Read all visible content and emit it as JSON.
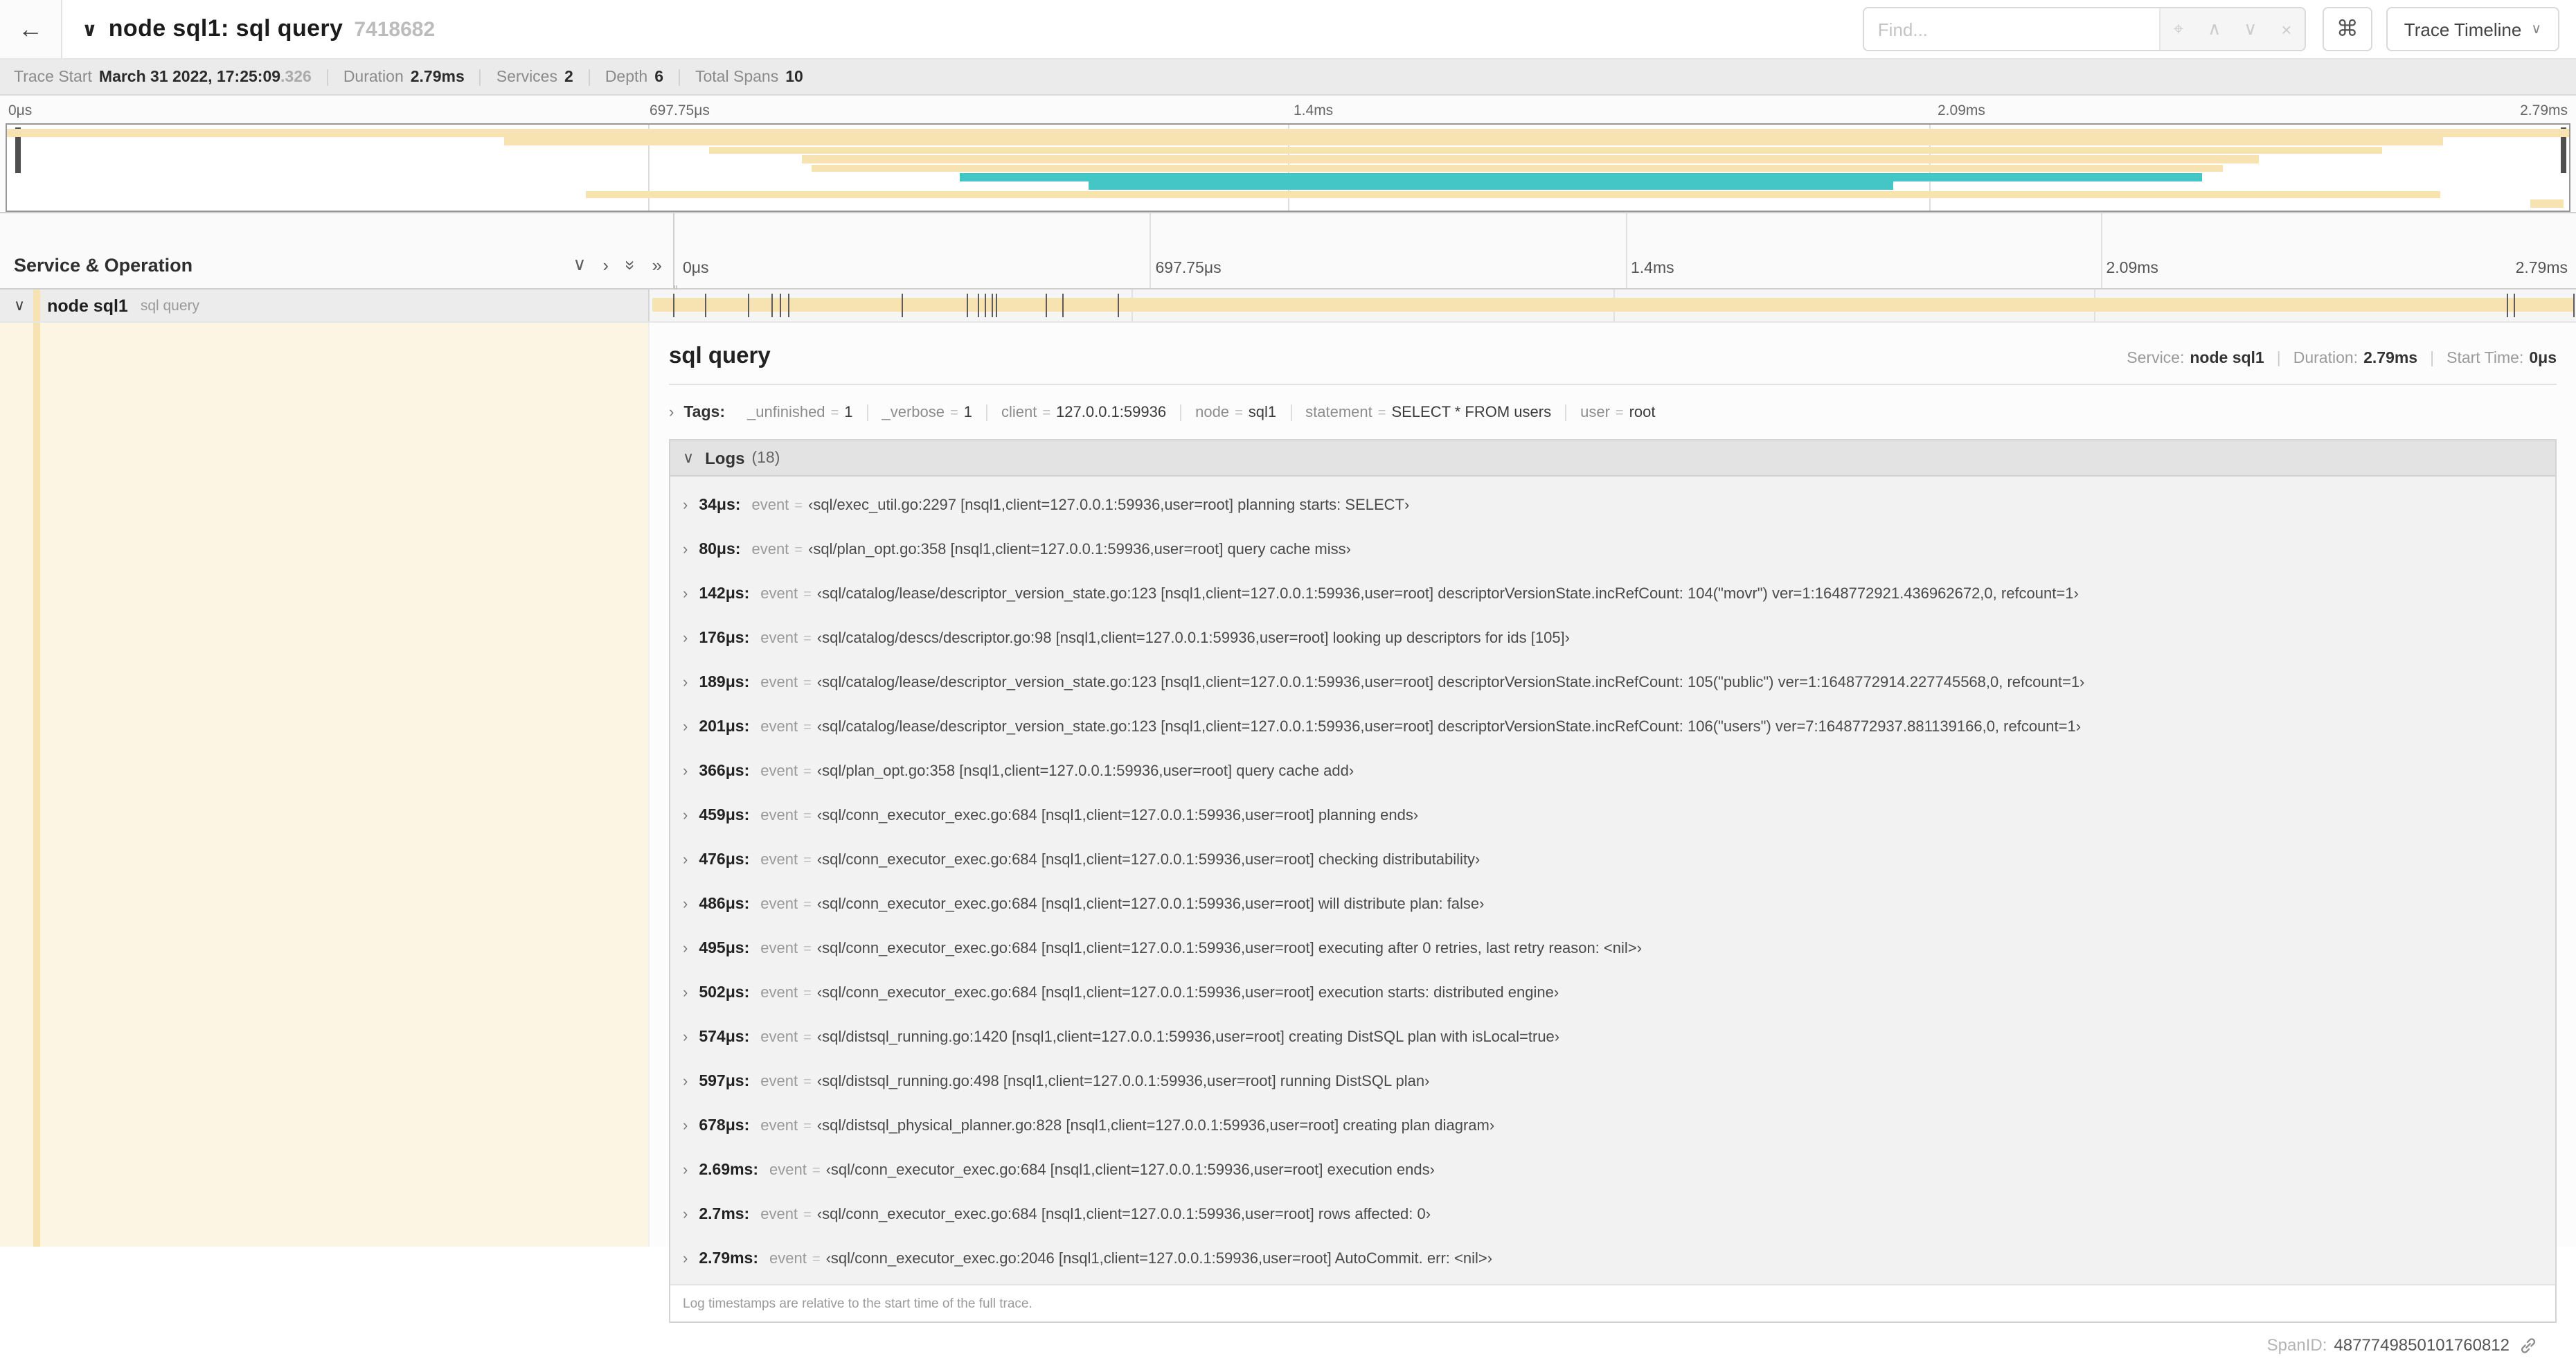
{
  "colors": {
    "tan": "#f7e2b2",
    "teal": "#45c6c6",
    "cream": "#fdf5e3"
  },
  "header": {
    "back_icon": "←",
    "collapse_icon": "∨",
    "title": "node sql1: sql query",
    "trace_id": "7418682",
    "find_placeholder": "Find...",
    "locate_icon": "⌖",
    "prev_icon": "∧",
    "next_icon": "∨",
    "clear_icon": "×",
    "shortcut_icon": "⌘",
    "view_dropdown": "Trace Timeline",
    "dropdown_caret": "∨"
  },
  "trace_meta": {
    "items": [
      {
        "label": "Trace Start",
        "value": "March 31 2022, 17:25:09",
        "suffix": ".326"
      },
      {
        "label": "Duration",
        "value": "2.79ms"
      },
      {
        "label": "Services",
        "value": "2"
      },
      {
        "label": "Depth",
        "value": "6"
      },
      {
        "label": "Total Spans",
        "value": "10"
      }
    ]
  },
  "minimap": {
    "labels": [
      "0μs",
      "697.75μs",
      "1.4ms",
      "2.09ms",
      "2.79ms"
    ],
    "spans": [
      {
        "row": 0,
        "start": 0.0,
        "end": 1.0,
        "color": "tan"
      },
      {
        "row": 1,
        "start": 0.194,
        "end": 0.951,
        "color": "tan"
      },
      {
        "row": 2,
        "start": 0.274,
        "end": 0.927,
        "color": "tan"
      },
      {
        "row": 3,
        "start": 0.31,
        "end": 0.879,
        "color": "tan"
      },
      {
        "row": 4,
        "start": 0.314,
        "end": 0.865,
        "color": "tan"
      },
      {
        "row": 5,
        "start": 0.372,
        "end": 0.857,
        "color": "teal"
      },
      {
        "row": 6,
        "start": 0.422,
        "end": 0.736,
        "color": "teal"
      },
      {
        "row": 7,
        "start": 0.226,
        "end": 0.95,
        "color": "tan"
      },
      {
        "row": 8,
        "start": 0.985,
        "end": 0.998,
        "color": "tan"
      }
    ]
  },
  "timeline": {
    "left_header": "Service & Operation",
    "collapse_one_icon": "∨",
    "expand_one_icon": "›",
    "collapse_all_icon": "»",
    "expand_all_icon": "»",
    "ruler": [
      "0μs",
      "697.75μs",
      "1.4ms",
      "2.09ms",
      "2.79ms"
    ],
    "row": {
      "chevron": "∨",
      "service": "node sql1",
      "operation": "sql query"
    },
    "total_us": 2790,
    "tick_times_us": [
      34,
      80,
      142,
      176,
      189,
      201,
      366,
      459,
      476,
      486,
      495,
      502,
      574,
      597,
      678,
      2690,
      2700,
      2786
    ]
  },
  "detail": {
    "title": "sql query",
    "service_label": "Service:",
    "service": "node sql1",
    "duration_label": "Duration:",
    "duration": "2.79ms",
    "start_label": "Start Time:",
    "start": "0μs",
    "tags_toggle_icon": "›",
    "tags_label": "Tags:",
    "tags": [
      {
        "key": "_unfinished",
        "value": "1"
      },
      {
        "key": "_verbose",
        "value": "1"
      },
      {
        "key": "client",
        "value": "127.0.0.1:59936"
      },
      {
        "key": "node",
        "value": "sql1"
      },
      {
        "key": "statement",
        "value": "SELECT * FROM users"
      },
      {
        "key": "user",
        "value": "root"
      }
    ],
    "logs_collapse_icon": "∨",
    "logs_label": "Logs",
    "logs_count": "(18)",
    "log_field_key": "event",
    "logs": [
      {
        "t": "34μs:",
        "v": "‹sql/exec_util.go:2297 [nsql1,client=127.0.0.1:59936,user=root] planning starts: SELECT›"
      },
      {
        "t": "80μs:",
        "v": "‹sql/plan_opt.go:358 [nsql1,client=127.0.0.1:59936,user=root] query cache miss›"
      },
      {
        "t": "142μs:",
        "v": "‹sql/catalog/lease/descriptor_version_state.go:123 [nsql1,client=127.0.0.1:59936,user=root] descriptorVersionState.incRefCount: 104(\"movr\") ver=1:1648772921.436962672,0, refcount=1›"
      },
      {
        "t": "176μs:",
        "v": "‹sql/catalog/descs/descriptor.go:98 [nsql1,client=127.0.0.1:59936,user=root] looking up descriptors for ids [105]›"
      },
      {
        "t": "189μs:",
        "v": "‹sql/catalog/lease/descriptor_version_state.go:123 [nsql1,client=127.0.0.1:59936,user=root] descriptorVersionState.incRefCount: 105(\"public\") ver=1:1648772914.227745568,0, refcount=1›"
      },
      {
        "t": "201μs:",
        "v": "‹sql/catalog/lease/descriptor_version_state.go:123 [nsql1,client=127.0.0.1:59936,user=root] descriptorVersionState.incRefCount: 106(\"users\") ver=7:1648772937.881139166,0, refcount=1›"
      },
      {
        "t": "366μs:",
        "v": "‹sql/plan_opt.go:358 [nsql1,client=127.0.0.1:59936,user=root] query cache add›"
      },
      {
        "t": "459μs:",
        "v": "‹sql/conn_executor_exec.go:684 [nsql1,client=127.0.0.1:59936,user=root] planning ends›"
      },
      {
        "t": "476μs:",
        "v": "‹sql/conn_executor_exec.go:684 [nsql1,client=127.0.0.1:59936,user=root] checking distributability›"
      },
      {
        "t": "486μs:",
        "v": "‹sql/conn_executor_exec.go:684 [nsql1,client=127.0.0.1:59936,user=root] will distribute plan: false›"
      },
      {
        "t": "495μs:",
        "v": "‹sql/conn_executor_exec.go:684 [nsql1,client=127.0.0.1:59936,user=root] executing after 0 retries, last retry reason: <nil>›"
      },
      {
        "t": "502μs:",
        "v": "‹sql/conn_executor_exec.go:684 [nsql1,client=127.0.0.1:59936,user=root] execution starts: distributed engine›"
      },
      {
        "t": "574μs:",
        "v": "‹sql/distsql_running.go:1420 [nsql1,client=127.0.0.1:59936,user=root] creating DistSQL plan with isLocal=true›"
      },
      {
        "t": "597μs:",
        "v": "‹sql/distsql_running.go:498 [nsql1,client=127.0.0.1:59936,user=root] running DistSQL plan›"
      },
      {
        "t": "678μs:",
        "v": "‹sql/distsql_physical_planner.go:828 [nsql1,client=127.0.0.1:59936,user=root] creating plan diagram›"
      },
      {
        "t": "2.69ms:",
        "v": "‹sql/conn_executor_exec.go:684 [nsql1,client=127.0.0.1:59936,user=root] execution ends›"
      },
      {
        "t": "2.7ms:",
        "v": "‹sql/conn_executor_exec.go:684 [nsql1,client=127.0.0.1:59936,user=root] rows affected: 0›"
      },
      {
        "t": "2.79ms:",
        "v": "‹sql/conn_executor_exec.go:2046 [nsql1,client=127.0.0.1:59936,user=root] AutoCommit. err: <nil>›"
      }
    ],
    "footer_note": "Log timestamps are relative to the start time of the full trace.",
    "spanid_label": "SpanID:",
    "spanid": "4877749850101760812"
  }
}
